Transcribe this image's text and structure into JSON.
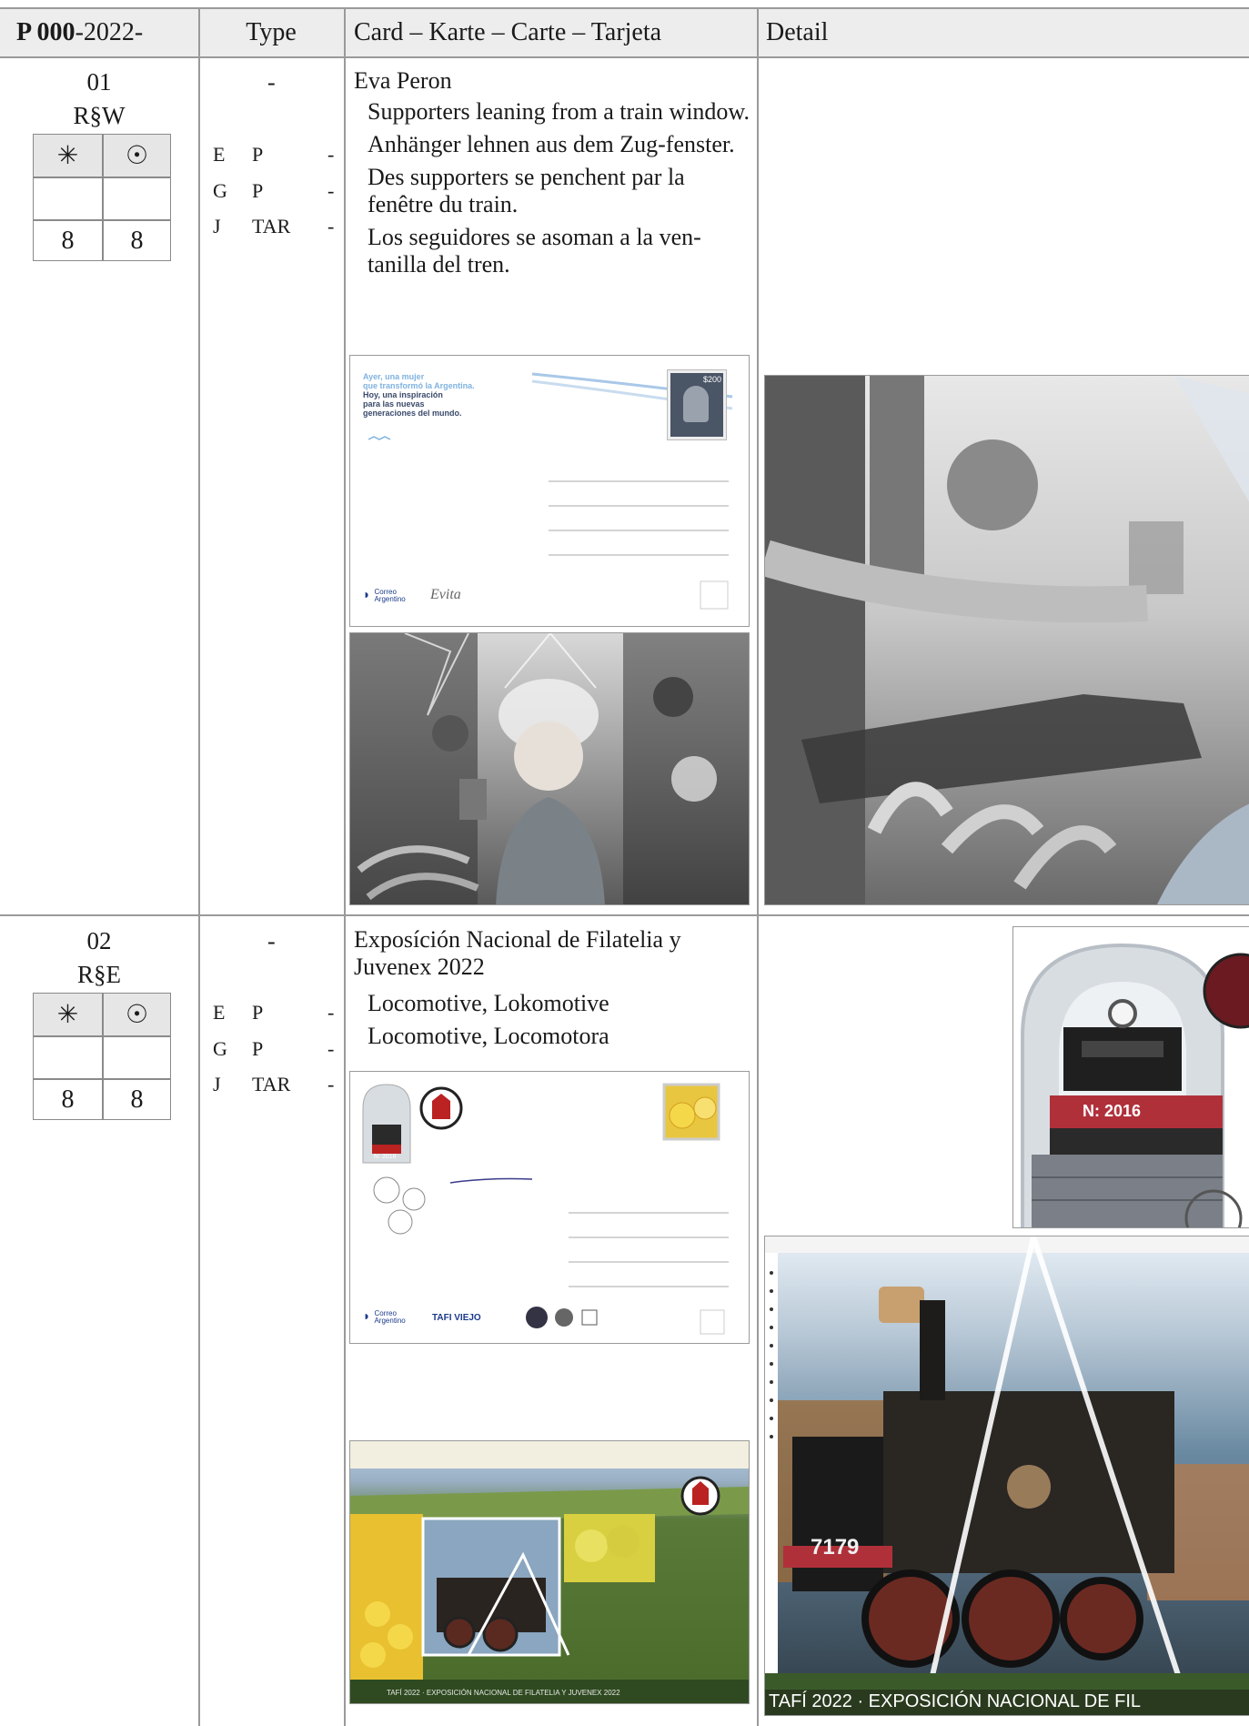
{
  "header": {
    "ref_bold": "P 000",
    "ref_rest": "-2022-",
    "type": "Type",
    "card": "Card – Karte – Carte – Tarjeta",
    "detail": "Detail"
  },
  "symbols": {
    "mint": "✳",
    "used": "☉"
  },
  "entries": [
    {
      "number": "01",
      "code": "R§W",
      "mint_value": "8",
      "used_value": "8",
      "type_dash": "-",
      "type_rows": [
        {
          "lang": "E",
          "kind": "P",
          "dash": "-"
        },
        {
          "lang": "G",
          "kind": "P",
          "dash": "-"
        },
        {
          "lang": "J",
          "kind": "TAR",
          "dash": "-"
        }
      ],
      "title": "Eva Peron",
      "descriptions": [
        "Supporters leaning from a train window.",
        "Anhänger lehnen aus dem Zug-fenster.",
        "Des supporters se penchent par la fenêtre du train.",
        "Los seguidores se asoman a la ven-tanilla del tren."
      ],
      "card_front_text": {
        "line1": "Ayer, una mujer",
        "line2": "que transformó la Argentina.",
        "line3": "Hoy, una inspiración",
        "line4": "para las nuevas",
        "line5": "generaciones del mundo.",
        "stamp_value": "$200",
        "brand": "Correo Argentino",
        "signature": "Evita"
      }
    },
    {
      "number": "02",
      "code": "R§E",
      "mint_value": "8",
      "used_value": "8",
      "type_dash": "-",
      "type_rows": [
        {
          "lang": "E",
          "kind": "P",
          "dash": "-"
        },
        {
          "lang": "G",
          "kind": "P",
          "dash": "-"
        },
        {
          "lang": "J",
          "kind": "TAR",
          "dash": "-"
        }
      ],
      "title": "Exposíción Nacional de Filatelia y Juvenex 2022",
      "descriptions": [
        "Locomotive, Lokomotive",
        "Locomotive, Locomotora"
      ],
      "card_front_text": {
        "brand": "Correo Argentino",
        "tafi": "TAFI VIEJO",
        "loco_plate": "N: 2016",
        "expo_title": "TAFÍ 2022 · EXPOSICIÓN NACIONAL DE FILATELIA Y JUVENEX 2022",
        "loco_number": "7179",
        "detail_caption": "TAFÍ 2022 · EXPOSICIÓN NACIONAL DE FIL"
      }
    }
  ]
}
